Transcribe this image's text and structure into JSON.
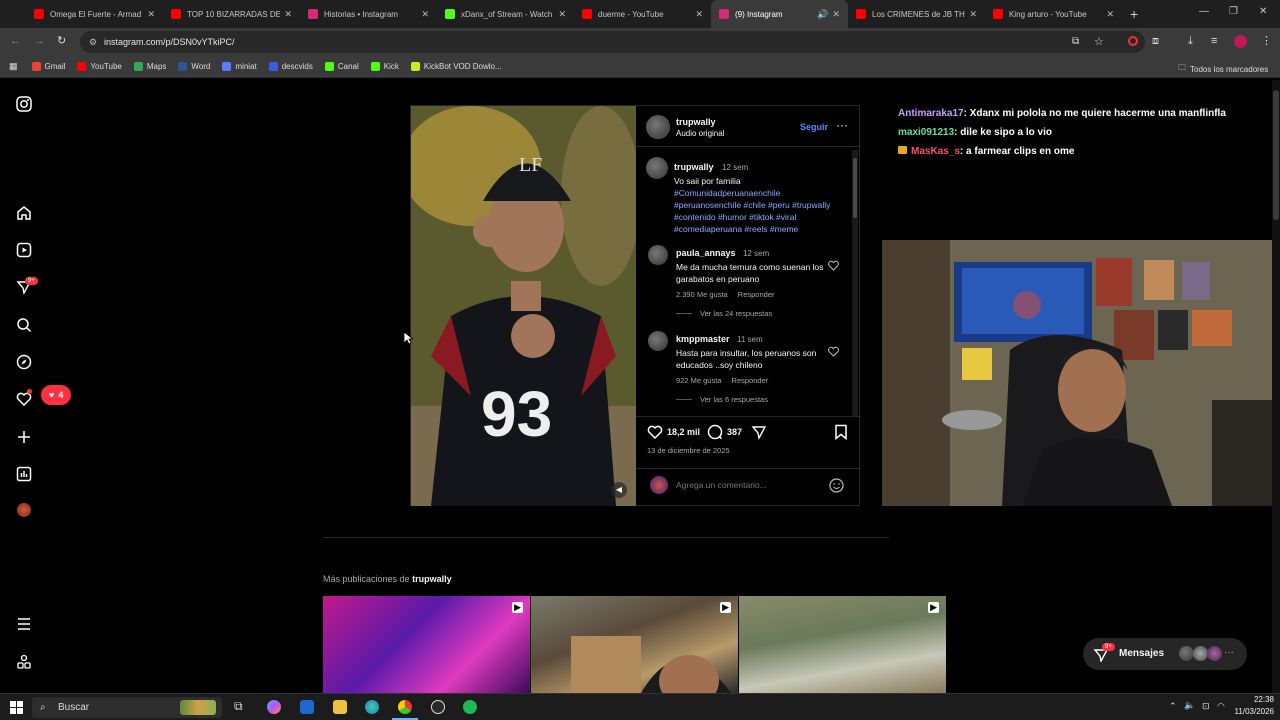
{
  "browser": {
    "tabs": [
      {
        "title": "Omega El Fuerte - Armad",
        "color": "#ff0000"
      },
      {
        "title": "TOP 10 BIZARRADAS DEL",
        "color": "#ff0000"
      },
      {
        "title": "Historias • Instagram",
        "color": "#d62976"
      },
      {
        "title": "xDanx_of Stream - Watch",
        "color": "#53fc18"
      },
      {
        "title": "duerme - YouTube",
        "color": "#ff0000"
      },
      {
        "title": "(9) Instagram",
        "color": "#d62976",
        "active": true
      },
      {
        "title": "Los CRIMENES de JB THE",
        "color": "#ff0000"
      },
      {
        "title": "King arturo - YouTube",
        "color": "#ff0000"
      }
    ],
    "url": "instagram.com/p/DSN0vYTkiPC/",
    "bookmarks": [
      "Gmail",
      "YouTube",
      "Maps",
      "Word",
      "miniat",
      "descvids",
      "Canal",
      "Kick",
      "KickBot VOD Dowlo..."
    ],
    "all_bookmarks": "Todos los marcadores"
  },
  "sidebar": {
    "notifications_badge": "9+",
    "likes_badge": "4"
  },
  "post": {
    "author": "trupwally",
    "audio": "Audio original",
    "follow": "Seguir",
    "caption_author": "trupwally",
    "caption_time": "12 sem",
    "caption_text": "Vo saii por familia",
    "caption_tags": "#Comunidadperuanaenchile #peruanosenchile #chile #peru #trupwally #contenido #humor #tiktok #viral #comediaperuana #reels #meme",
    "comments": [
      {
        "user": "paula_annays",
        "time": "12 sem",
        "text": "Me da mucha ternura como suenan los garabatos en peruano",
        "likes": "2.390 Me gusta",
        "reply": "Responder",
        "view_replies": "Ver las 24 respuestas"
      },
      {
        "user": "kmppmaster",
        "time": "11 sem",
        "text": "Hasta para insultar, los peruanos son educados ..soy chileno",
        "likes": "922 Me gusta",
        "reply": "Responder",
        "view_replies": "Ver las 6 respuestas"
      }
    ],
    "like_count": "18,2 mil",
    "comment_count": "387",
    "date": "13 de diciembre de 2025",
    "add_comment_placeholder": "Agrega un comentario..."
  },
  "chat": [
    {
      "user": "Antimaraka17",
      "color": "#c99cff",
      "text": ": Xdanx mi polola no me quiere hacerme una manflinfla"
    },
    {
      "user": "maxi091213",
      "color": "#5fe39a",
      "text": ": dile ke sipo a lo vio"
    },
    {
      "user": "MasKas_s",
      "color": "#ff4d6d",
      "text": ": a farmear clips en ome"
    }
  ],
  "more_posts": {
    "label": "Más publicaciones de",
    "author": "trupwally"
  },
  "messages": {
    "label": "Mensajes",
    "badge": "9+"
  },
  "taskbar": {
    "search": "Buscar",
    "time": "22:38",
    "date": "11/03/2026"
  }
}
